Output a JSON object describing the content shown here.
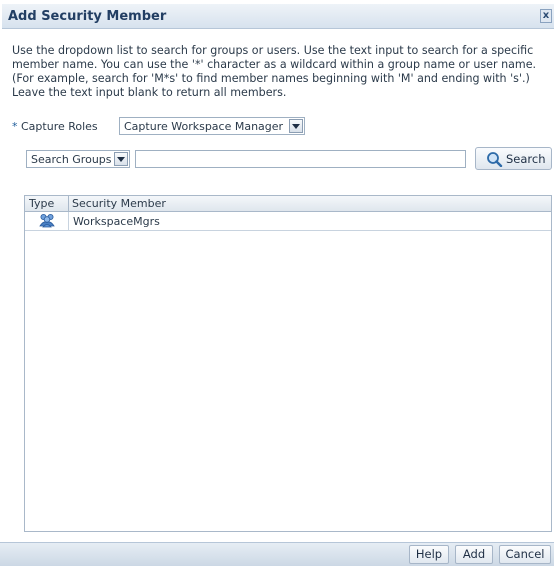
{
  "dialog": {
    "title": "Add Security Member",
    "close_glyph": "x",
    "instructions": "Use the dropdown list to search for groups or users. Use the text input to search for a specific member name. You can use the '*' character as a wildcard within a group name or user name. (For example, search for 'M*s' to find member names beginning with 'M' and ending with 's'.) Leave the text input blank to return all members."
  },
  "roles": {
    "required_marker": "*",
    "label": "Capture Roles",
    "selected": "Capture Workspace Manager"
  },
  "search": {
    "type_selected": "Search Groups",
    "input_value": "",
    "button_label": "Search"
  },
  "table": {
    "columns": [
      "Type",
      "Security Member"
    ],
    "rows": [
      {
        "type_icon": "group-icon",
        "member": "WorkspaceMgrs"
      }
    ]
  },
  "footer": {
    "help_label": "Help",
    "add_label": "Add",
    "cancel_label": "Cancel"
  },
  "colors": {
    "title_text": "#223e63",
    "accent": "#1e5c9a",
    "border": "#a9b8c9"
  }
}
